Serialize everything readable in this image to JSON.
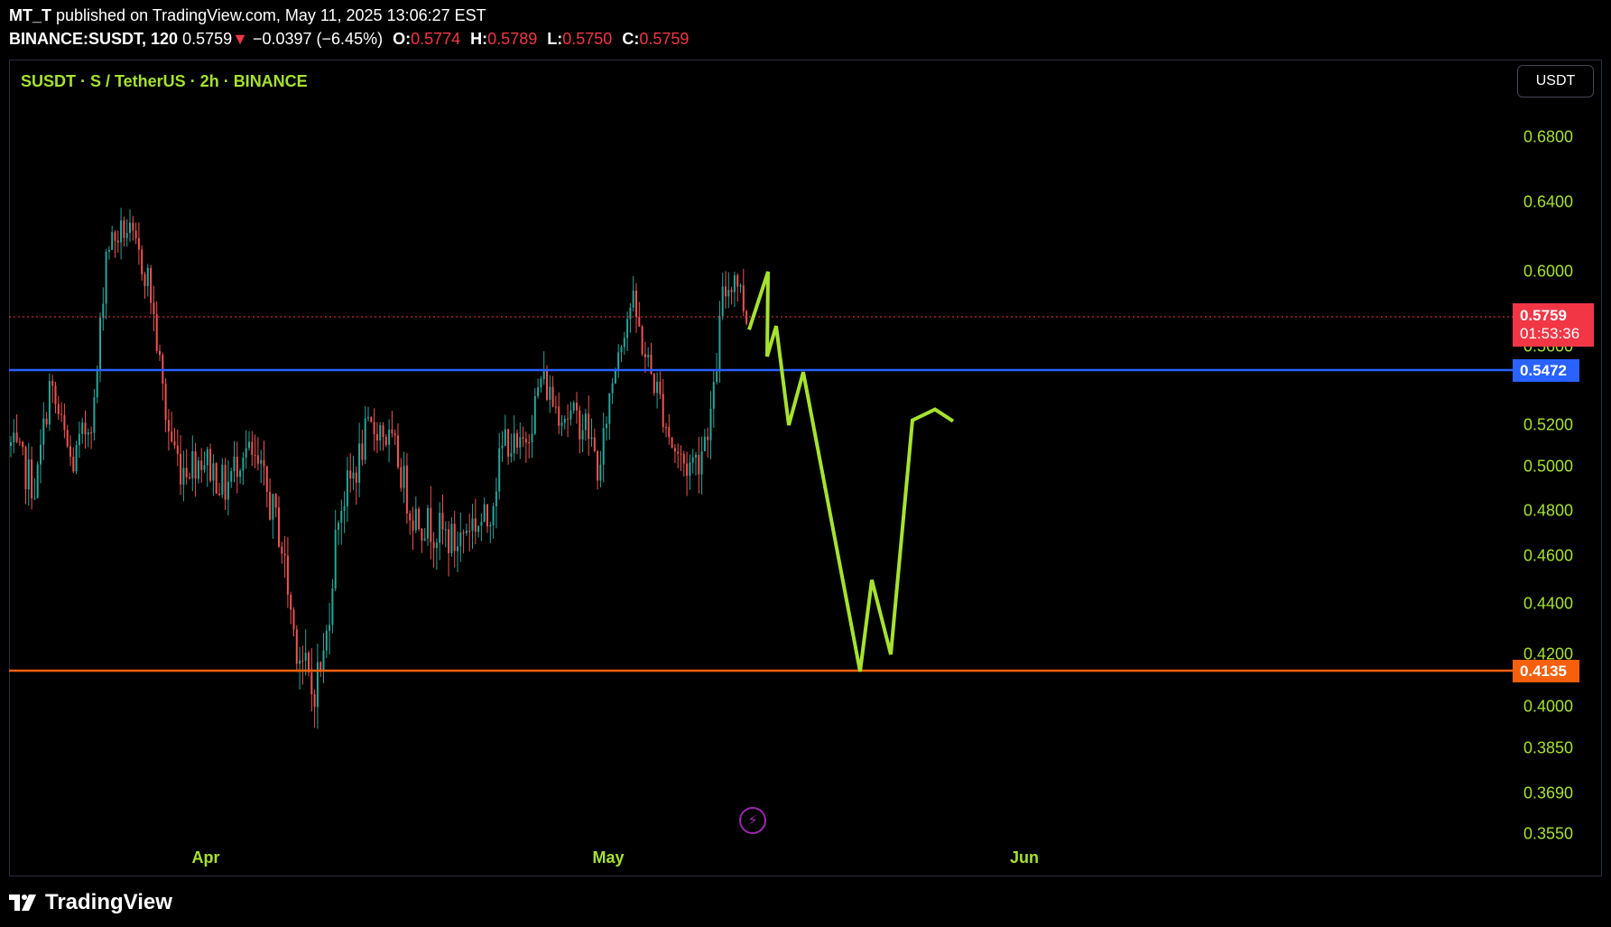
{
  "header": {
    "user": "MT_T",
    "published_text": " published on TradingView.com, May 11, 2025 13:06:27 EST",
    "symbol": "BINANCE:SUSDT, 120",
    "last": "0.5759",
    "arrow": "▼",
    "change": "−0.0397 (−6.45%)",
    "o_label": "O:",
    "o_value": "0.5774",
    "h_label": "H:",
    "h_value": "0.5789",
    "l_label": "L:",
    "l_value": "0.5750",
    "c_label": "C:",
    "c_value": "0.5759"
  },
  "legend": "SUSDT · S / TetherUS · 2h · BINANCE",
  "currency_button": "USDT",
  "price_scale": {
    "ticks": [
      "0.6800",
      "0.6400",
      "0.6000",
      "0.5600",
      "0.5200",
      "0.5000",
      "0.4800",
      "0.4600",
      "0.4400",
      "0.4200",
      "0.4000",
      "0.3850",
      "0.3690",
      "0.3550"
    ],
    "last_price": "0.5759",
    "countdown": "01:53:36",
    "blue_level": "0.5472",
    "orange_level": "0.4135"
  },
  "time_scale": {
    "ticks": [
      "Apr",
      "May",
      "Jun"
    ]
  },
  "footer": {
    "brand": "TradingView"
  },
  "colors": {
    "up": "#26a69a",
    "down": "#ef5350",
    "blue_line": "#2962ff",
    "orange_line": "#f7600b",
    "projection": "#a6e22e",
    "accent_text": "#a6e22e"
  },
  "icons": {
    "indicator": "flash-icon",
    "logo": "tradingview-logo-icon"
  },
  "chart_data": {
    "type": "candlestick",
    "interval": "2h",
    "last_price": 0.5759,
    "horizontal_levels": [
      0.5472,
      0.4135
    ],
    "projection_path": [
      0.569,
      0.6,
      0.555,
      0.571,
      0.52,
      0.547,
      0.4135,
      0.45,
      0.42,
      0.5225,
      0.528,
      0.522
    ]
  }
}
